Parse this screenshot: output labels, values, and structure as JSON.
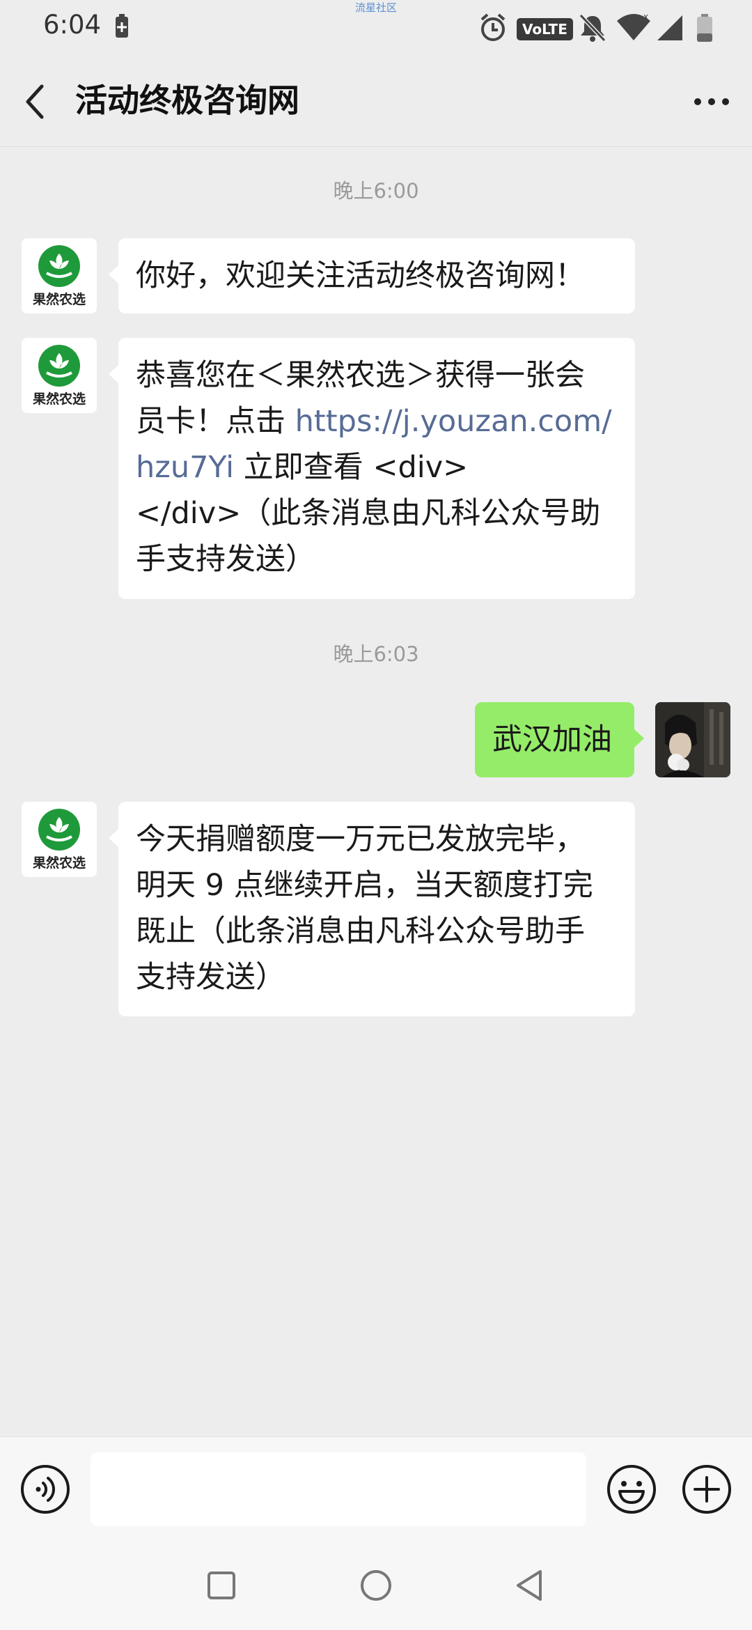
{
  "status_bar": {
    "time": "6:04",
    "watermark": "流星社区",
    "network_badge": "VoLTE",
    "icons": [
      "battery-saver-icon",
      "alarm-icon",
      "volte-icon",
      "mute-icon",
      "wifi-icon",
      "signal-icon",
      "battery-icon"
    ]
  },
  "header": {
    "title": "活动终极咨询网",
    "back_icon": "back-arrow-icon",
    "more_icon": "more-dots-icon"
  },
  "chat": {
    "timestamps": [
      "晚上6:00",
      "晚上6:03"
    ],
    "sender_avatar_brand": "果然农选",
    "messages": [
      {
        "side": "left",
        "text": "你好，欢迎关注活动终极咨询网！"
      },
      {
        "side": "left",
        "line1": "恭喜您在＜果然农选＞获得一张会",
        "line2_prefix": "员卡！点击 ",
        "link_line1": "https://j.youzan.com/",
        "link_line2": "hzu7Yi",
        "line3_suffix": " 立即查看 <div>",
        "line4": "</div>（此条消息由凡科公众号助",
        "line5": "手支持发送）"
      },
      {
        "side": "right",
        "text": "武汉加油"
      },
      {
        "side": "left",
        "line1": "今天捐赠额度一万元已发放完毕，",
        "line2": "明天 9 点继续开启，当天额度打完",
        "line3": "既止（此条消息由凡科公众号助手",
        "line4": "支持发送）"
      }
    ]
  },
  "input_bar": {
    "value": "",
    "icons": [
      "voice-icon",
      "emoji-icon",
      "plus-icon"
    ]
  },
  "nav_bar": {
    "icons": [
      "recents-square-icon",
      "home-circle-icon",
      "back-triangle-icon"
    ]
  },
  "colors": {
    "background": "#ededed",
    "bubble_self": "#95ec69",
    "bubble_other": "#ffffff",
    "link": "#576b95",
    "brand_green": "#1f9a3a"
  }
}
